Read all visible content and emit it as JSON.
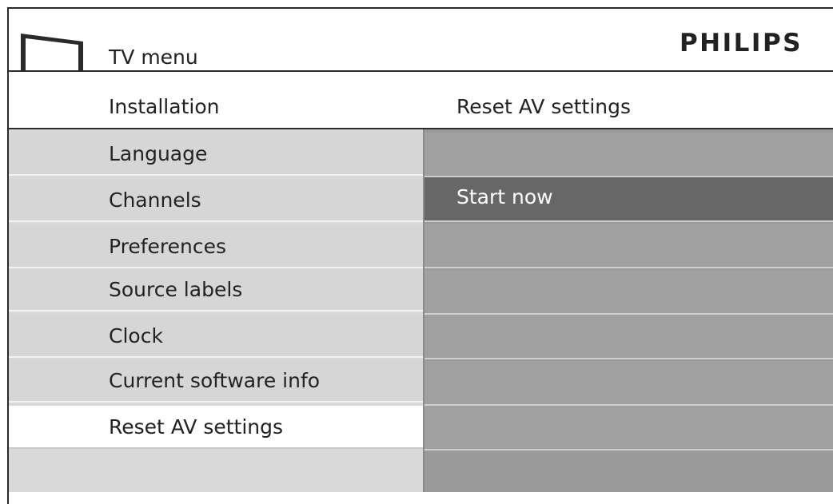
{
  "header": {
    "title": "TV menu",
    "brand": "PHILIPS",
    "icon": "tv-icon"
  },
  "breadcrumb": {
    "left": "Installation",
    "right": "Reset AV settings"
  },
  "left_menu": {
    "items": [
      {
        "label": "Language"
      },
      {
        "label": "Channels"
      },
      {
        "label": "Preferences"
      },
      {
        "label": "Source labels"
      },
      {
        "label": "Clock"
      },
      {
        "label": "Current software info"
      },
      {
        "label": "Reset AV settings",
        "selected": true
      }
    ]
  },
  "right_menu": {
    "items": [
      {
        "label": ""
      },
      {
        "label": "Start now",
        "selected": true
      },
      {
        "label": ""
      },
      {
        "label": ""
      },
      {
        "label": ""
      },
      {
        "label": ""
      },
      {
        "label": ""
      }
    ]
  },
  "colors": {
    "left_item_bg": "#d6d6d6",
    "left_selected_bg": "#ffffff",
    "right_item_bg": "#a0a0a0",
    "right_selected_bg": "#676767",
    "frame_line": "#2a2a2a"
  }
}
